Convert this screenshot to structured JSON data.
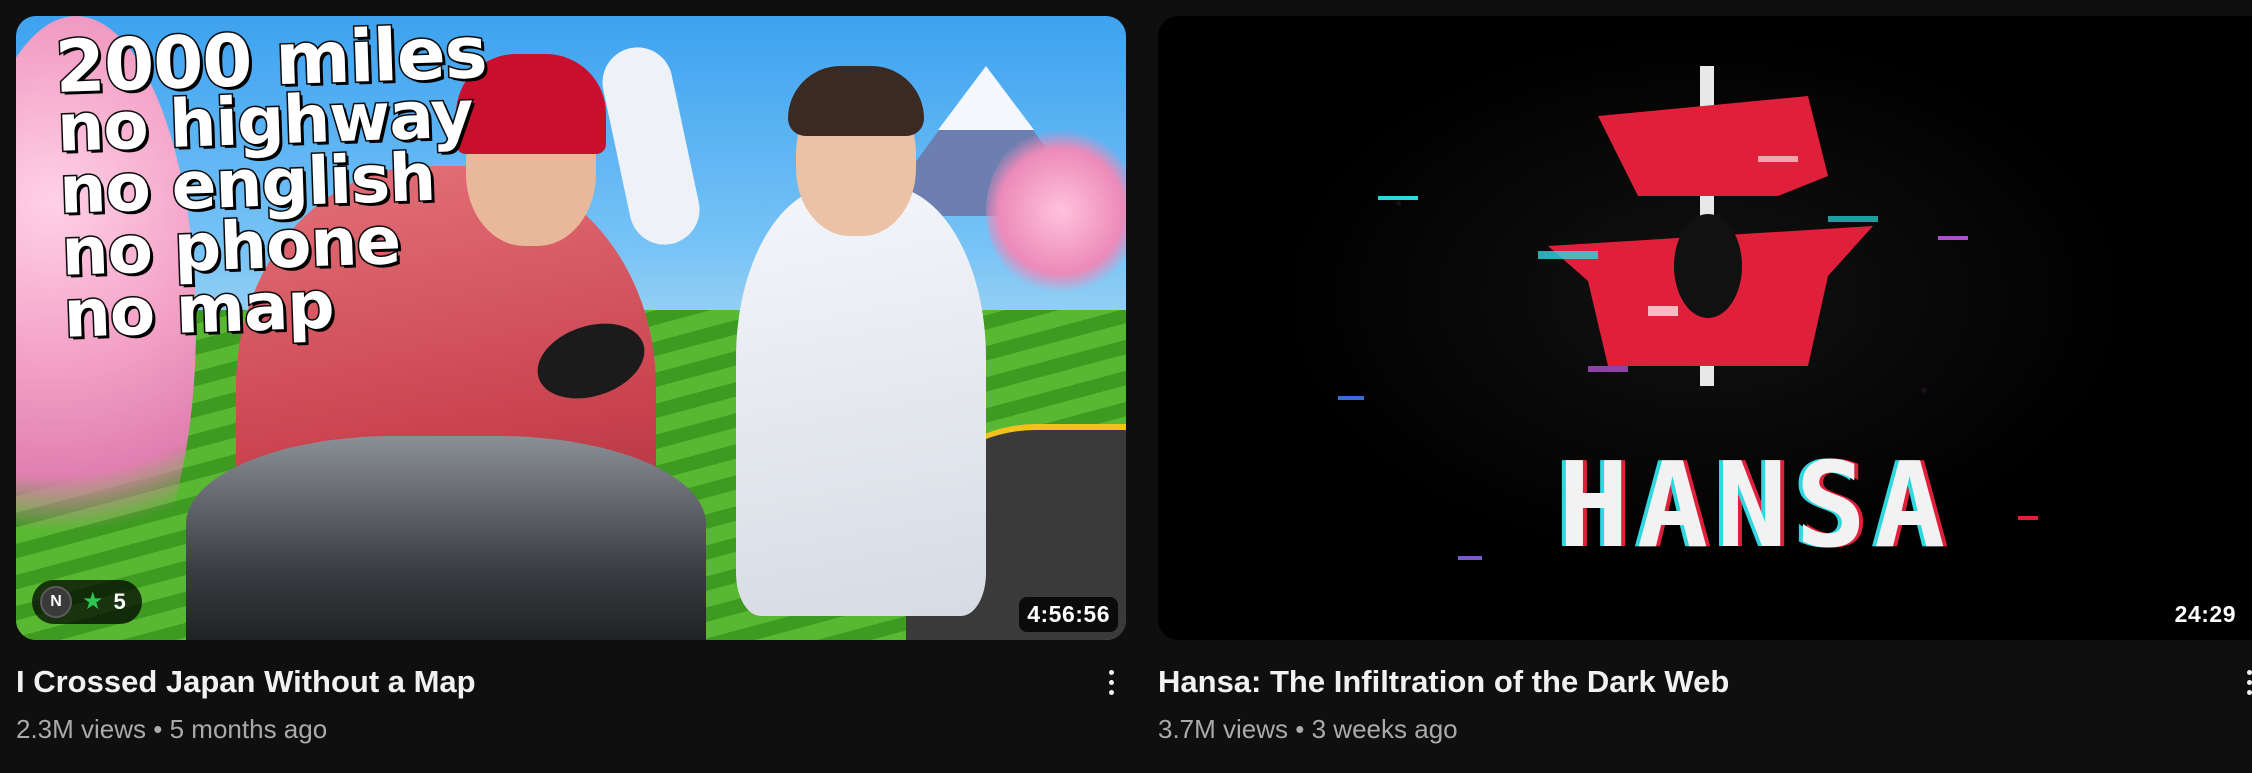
{
  "videos": [
    {
      "title": "I Crossed Japan Without a Map",
      "views": "2.3M views",
      "age": "5 months ago",
      "duration": "4:56:56",
      "thumbnail_text": [
        "2000 miles",
        "no highway",
        "no english",
        "no phone",
        "no map"
      ],
      "members_badge": {
        "avatar_letter": "N",
        "icon": "star-icon",
        "count": "5"
      },
      "separator": "•"
    },
    {
      "title": "Hansa: The Infiltration of the Dark Web",
      "views": "3.7M views",
      "age": "3 weeks ago",
      "duration": "24:29",
      "thumbnail_text": "HANSA",
      "separator": "•"
    }
  ],
  "colors": {
    "background": "#0f0f0f",
    "title_text": "#f1f1f1",
    "meta_text": "#aaaaaa",
    "star": "#2ec451",
    "hansa_red": "#e0203a"
  }
}
